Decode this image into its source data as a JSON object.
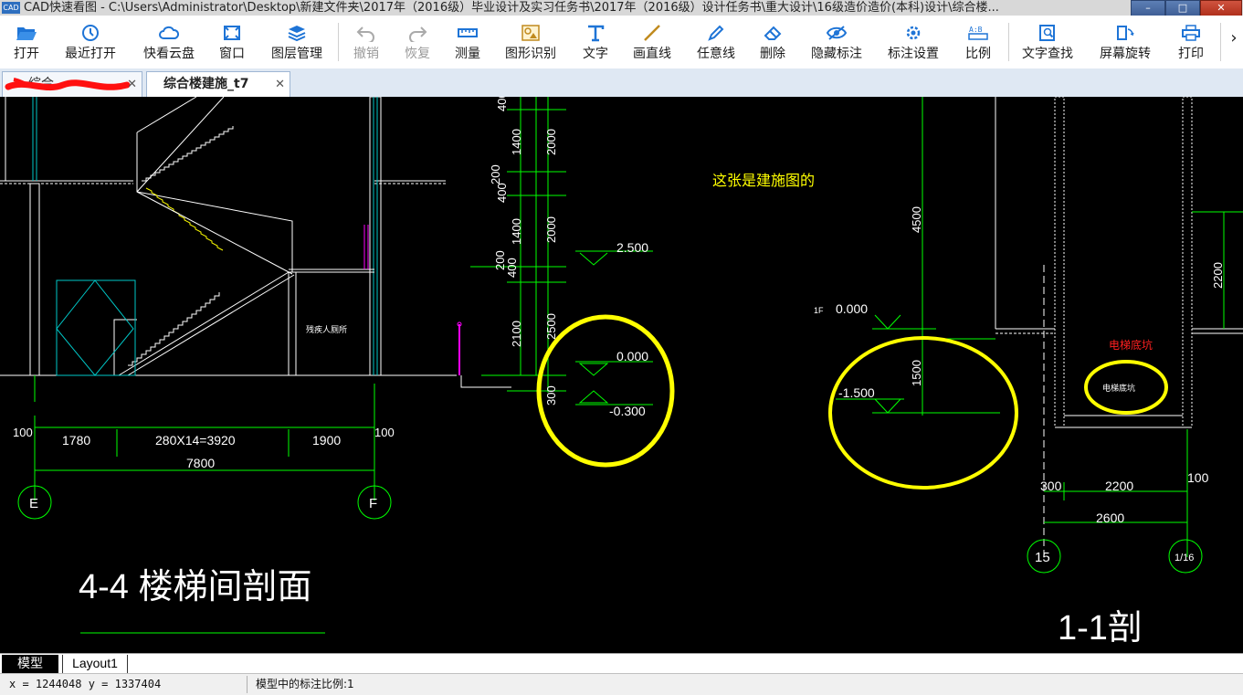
{
  "window": {
    "title": "CAD快速看图 - C:\\Users\\Administrator\\Desktop\\新建文件夹\\2017年（2016级）毕业设计及实习任务书\\2017年（2016级）设计任务书\\重大设计\\16级造价造价(本科)设计\\综合楼...",
    "app_icon_text": "CAD",
    "minimize": "–",
    "maximize": "□",
    "close": "✕"
  },
  "toolbar": {
    "items": [
      {
        "label": "打开",
        "icon": "folder-open-icon"
      },
      {
        "label": "最近打开",
        "icon": "history-icon"
      },
      {
        "label": "快看云盘",
        "icon": "cloud-icon"
      },
      {
        "label": "窗口",
        "icon": "window-icon"
      },
      {
        "label": "图层管理",
        "icon": "layers-icon"
      },
      {
        "label": "撤销",
        "icon": "undo-icon"
      },
      {
        "label": "恢复",
        "icon": "redo-icon"
      },
      {
        "label": "测量",
        "icon": "ruler-icon"
      },
      {
        "label": "图形识别",
        "icon": "shape-recognition-icon"
      },
      {
        "label": "文字",
        "icon": "text-icon"
      },
      {
        "label": "画直线",
        "icon": "line-icon"
      },
      {
        "label": "任意线",
        "icon": "pen-icon"
      },
      {
        "label": "删除",
        "icon": "eraser-icon"
      },
      {
        "label": "隐藏标注",
        "icon": "eye-icon"
      },
      {
        "label": "标注设置",
        "icon": "settings-icon"
      },
      {
        "label": "比例",
        "icon": "scale-icon"
      },
      {
        "label": "文字查找",
        "icon": "find-text-icon"
      },
      {
        "label": "屏幕旋转",
        "icon": "rotate-icon"
      },
      {
        "label": "打印",
        "icon": "printer-icon"
      }
    ],
    "more": "›"
  },
  "tabs": [
    {
      "label": "综合...",
      "close": "✕"
    },
    {
      "label": "综合楼建施_t7",
      "close": "✕"
    }
  ],
  "drawing": {
    "stair": {
      "handrail_label": "残疾人厕所",
      "dims_bottom": [
        "100",
        "1780",
        "280X14=3920",
        "1900",
        "100"
      ],
      "total": "7800",
      "axis_left": "E",
      "axis_right": "F",
      "title": "4-4 楼梯间剖面"
    },
    "middle": {
      "dims_vertical": [
        "400",
        "1400",
        "2000",
        "400",
        "200",
        "1400",
        "2000",
        "400",
        "200",
        "2100",
        "2500",
        "300"
      ],
      "elev_1": "2.500",
      "elev_2": "0.000",
      "elev_3": "-0.300",
      "note": "这张是建施图的"
    },
    "right": {
      "floor": "1F",
      "elev_top": "0.000",
      "elev_bottom": "-1.500",
      "dim_4500": "4500",
      "dim_1500": "1500",
      "dim_2200_v": "2200",
      "pit_label_red": "电梯底坑",
      "pit_label_white": "电梯底坑",
      "dims_bottom": [
        "300",
        "2200",
        "100"
      ],
      "total": "2600",
      "axis_left": "15",
      "axis_right": "1/16",
      "title": "1-1剖"
    },
    "colors": {
      "green": "#00ff00",
      "yellow": "#ffff00",
      "white": "#ffffff",
      "magenta": "#ff00ff",
      "cyan": "#00c8c8",
      "red": "#ff2020"
    }
  },
  "layout_tabs": [
    "模型",
    "Layout1"
  ],
  "status": {
    "coords": "x = 1244048  y = 1337404",
    "scale": "模型中的标注比例:1"
  }
}
